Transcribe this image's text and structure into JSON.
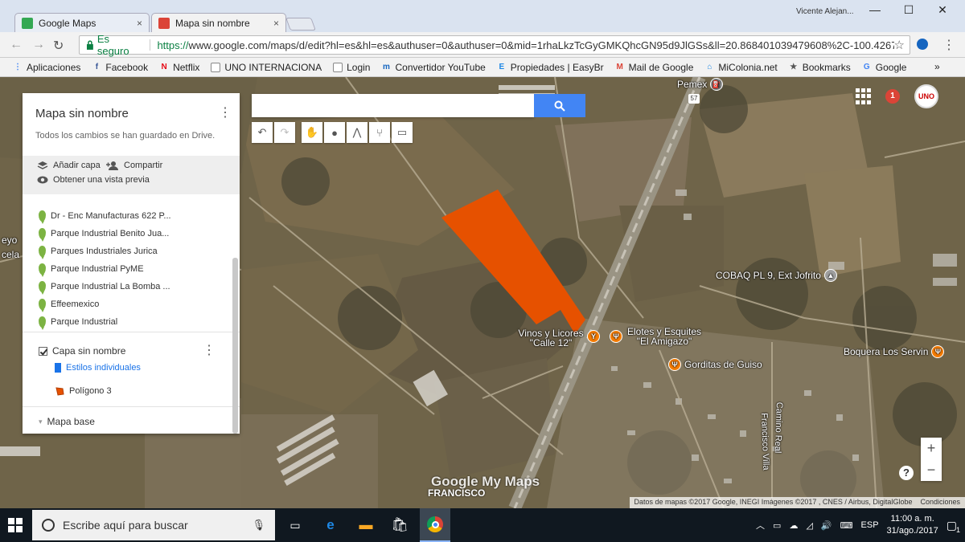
{
  "browser": {
    "tabs": [
      {
        "title": "Google Maps",
        "favicon_color": "#34a853"
      },
      {
        "title": "Mapa sin nombre",
        "favicon_color": "#db4437"
      }
    ],
    "close_label": "×",
    "user": "Vicente Alejan...",
    "window_controls": {
      "minimize": "—",
      "maximize": "☐",
      "close": "✕"
    },
    "back": "←",
    "forward": "→",
    "reload": "↻",
    "secure_label": "Es seguro",
    "url_proto": "https://",
    "url_rest": "www.google.com/maps/d/edit?hl=es&hl=es&authuser=0&authuser=0&mid=1rhaLkzTcGyGMKQhcGN95d9JlGSs&ll=20.868401039479608%2C-100.42670420225...",
    "star": "☆",
    "menu": "⋮"
  },
  "bookmarks": [
    {
      "label": "Aplicaciones",
      "icon": "apps-icon",
      "color": "#4285f4",
      "glyph": "⋮"
    },
    {
      "label": "Facebook",
      "icon": "facebook-icon",
      "color": "#3b5998",
      "glyph": "f"
    },
    {
      "label": "Netflix",
      "icon": "netflix-icon",
      "color": "#e50914",
      "glyph": "N"
    },
    {
      "label": "UNO INTERNACIONA",
      "icon": "page-icon",
      "color": "#888",
      "glyph": ""
    },
    {
      "label": "Login",
      "icon": "page-icon",
      "color": "#888",
      "glyph": ""
    },
    {
      "label": "Convertidor YouTube",
      "icon": "mp3-icon",
      "color": "#1565c0",
      "glyph": "m"
    },
    {
      "label": "Propiedades | EasyBr",
      "icon": "easybroker-icon",
      "color": "#1e88e5",
      "glyph": "E"
    },
    {
      "label": "Mail de Google",
      "icon": "gmail-icon",
      "color": "#db4437",
      "glyph": "M"
    },
    {
      "label": "MiColonia.net",
      "icon": "home-icon",
      "color": "#1e88e5",
      "glyph": "⌂"
    },
    {
      "label": "Bookmarks",
      "icon": "star-icon",
      "color": "#555",
      "glyph": "★"
    },
    {
      "label": "Google",
      "icon": "google-icon",
      "color": "#4285f4",
      "glyph": "G"
    }
  ],
  "bookmarks_more": "»",
  "map": {
    "search_placeholder": "",
    "tools": [
      "↶",
      "↷",
      "✋",
      "●",
      "⋀",
      "⑂",
      "▭"
    ],
    "zoom_in": "+",
    "zoom_out": "−",
    "help": "?",
    "notifications": "1",
    "avatar_text": "UNO",
    "polygon_color": "#e65100",
    "watermark": "Google My Maps",
    "watermark_sub": "FRANCISCO",
    "attribution": "Datos de mapas ©2017 Google, INEGI Imágenes ©2017 , CNES / Airbus, DigitalGlobe",
    "conditions": "Condiciones",
    "places": [
      {
        "name": "Pemex",
        "icon": "gas-station-icon",
        "glyph": "⛽"
      },
      {
        "name": "COBAQ PL 9, Ext Jofrito",
        "icon": "school-icon",
        "glyph": "▲"
      },
      {
        "name": "Vinos y Licores \"Calle 12\"",
        "icon": "bar-icon",
        "glyph": "Y"
      },
      {
        "name": "Elotes y Esquites \"El Amigazo\"",
        "icon": "restaurant-icon",
        "glyph": "Ψ"
      },
      {
        "name": "Gorditas de Guiso",
        "icon": "restaurant-icon",
        "glyph": "Ψ"
      },
      {
        "name": "Boquera Los Servin",
        "icon": "restaurant-icon",
        "glyph": "Ψ"
      }
    ],
    "roads": [
      "Francisco Villa",
      "Camino Real"
    ],
    "edge_text": [
      "eyo",
      "cela"
    ],
    "highway_shield": "57"
  },
  "panel": {
    "title": "Mapa sin nombre",
    "status": "Todos los cambios se han guardado en Drive.",
    "add_layer": "Añadir capa",
    "share": "Compartir",
    "preview": "Obtener una vista previa",
    "layers": [
      "Dr - Enc Manufacturas 622 P...",
      "Parque Industrial Benito Jua...",
      "Parques Industriales Jurica",
      "Parque Industrial PyME",
      "Parque Industrial La Bomba ...",
      "Effeemexico",
      "Parque Industrial"
    ],
    "user_layer": "Capa sin nombre",
    "styles_link": "Estilos individuales",
    "polygon_item": "Polígono 3",
    "base_map": "Mapa base"
  },
  "taskbar": {
    "search_placeholder": "Escribe aquí para buscar",
    "language": "ESP",
    "time": "11:00 a. m.",
    "date": "31/ago./2017",
    "notification_count": "1"
  }
}
